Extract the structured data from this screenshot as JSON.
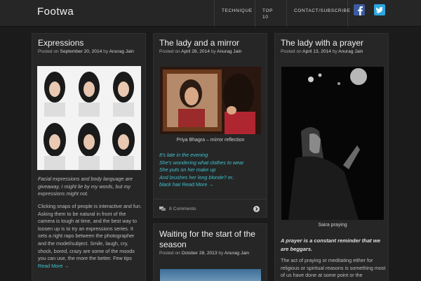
{
  "site": {
    "title": "Footwa"
  },
  "nav": {
    "items": [
      {
        "label": "TECHNIQUE"
      },
      {
        "label": "TOP 10"
      },
      {
        "label": "CONTACT/SUBSCRIBE"
      }
    ]
  },
  "social": {
    "facebook": "facebook-icon",
    "twitter": "twitter-icon"
  },
  "colors": {
    "accent": "#3fc3cf",
    "background": "#1b1b1b",
    "card": "#262626",
    "facebook": "#3b5ba0",
    "twitter": "#2ca7e0"
  },
  "posts": [
    {
      "title": "Expressions",
      "meta_prefix": "Posted on",
      "date": "September 20, 2014",
      "meta_by": "by",
      "author": "Anurag Jain",
      "intro": "Facial expressions and body language are giveaway, I might lie by my words, but my expressions might not.",
      "body": "Clicking snaps of people is interactive and fun. Asking them to be natural in front of the camera is tough at time, and the best way to loosen up is to try an expressions series. It sets a right rapo between the photographer and the model/subject. Smile, laugh, cry, shock, bored, crazy are some of the moods you can use, the more the better. Few tips",
      "read_more": "Read More →"
    },
    {
      "title": "The lady and a mirror",
      "meta_prefix": "Posted on",
      "date": "April 28, 2014",
      "meta_by": "by",
      "author": "Anurag Jain",
      "caption": "Priya Bhagra – mirror reflection",
      "lines": [
        "It's late in the evening",
        "She's wondering what clothes to wear",
        "She puts on her make up",
        "And brushes her long blonde? er.."
      ],
      "last_line": "black hair",
      "read_more": "Read More →",
      "comments": "8 Comments"
    },
    {
      "title": "Waiting for the start of the season",
      "meta_prefix": "Posted on",
      "date": "October 28, 2013",
      "meta_by": "by",
      "author": "Anurag Jain"
    },
    {
      "title": "The lady with a prayer",
      "meta_prefix": "Posted on",
      "date": "April 13, 2014",
      "meta_by": "by",
      "author": "Anurag Jain",
      "caption": "Saira praying",
      "quote": "A prayer is a constant reminder that we are beggars.",
      "body": "The act of praying or meditating either for religious or spiritual reasons is something most of us have done at some point or the"
    }
  ]
}
